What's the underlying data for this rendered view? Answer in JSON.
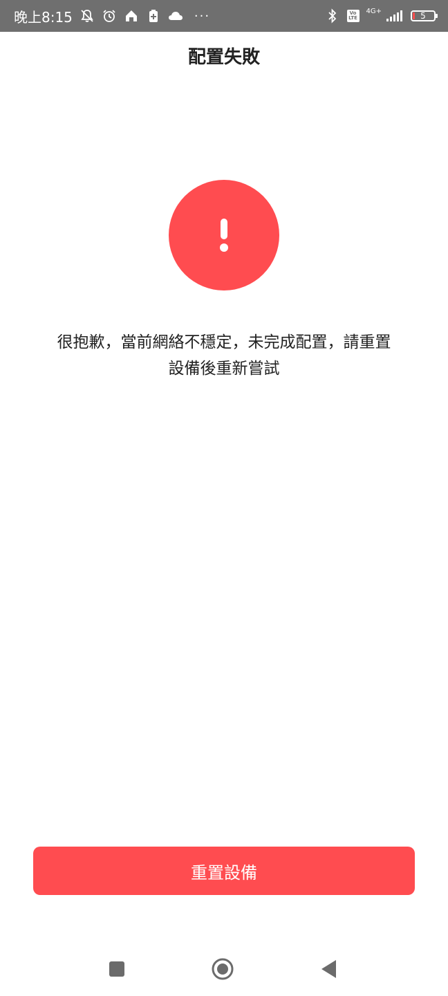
{
  "status_bar": {
    "time": "晚上8:15",
    "network": "4G+",
    "battery_level": "5",
    "icons": [
      "bell-off-icon",
      "alarm-icon",
      "home-icon",
      "battery-saver-icon",
      "cloud-icon",
      "more-dots-icon",
      "bluetooth-icon",
      "volte-icon",
      "signal-icon",
      "battery-icon"
    ],
    "dots": "···",
    "volte_top": "Vo",
    "volte_bottom": "LTE"
  },
  "page": {
    "title": "配置失敗",
    "icon": "exclamation-icon",
    "message_line1": "很抱歉，當前網絡不穩定，未完成配置，請重置",
    "message_line2": "設備後重新嘗試"
  },
  "actions": {
    "reset_label": "重置設備"
  },
  "nav_bar": {
    "icons": [
      "recents-square-icon",
      "home-circle-icon",
      "back-triangle-icon"
    ]
  },
  "colors": {
    "accent": "#ff4c50",
    "status_bar_bg": "#6f6f6f",
    "text": "#222222"
  }
}
